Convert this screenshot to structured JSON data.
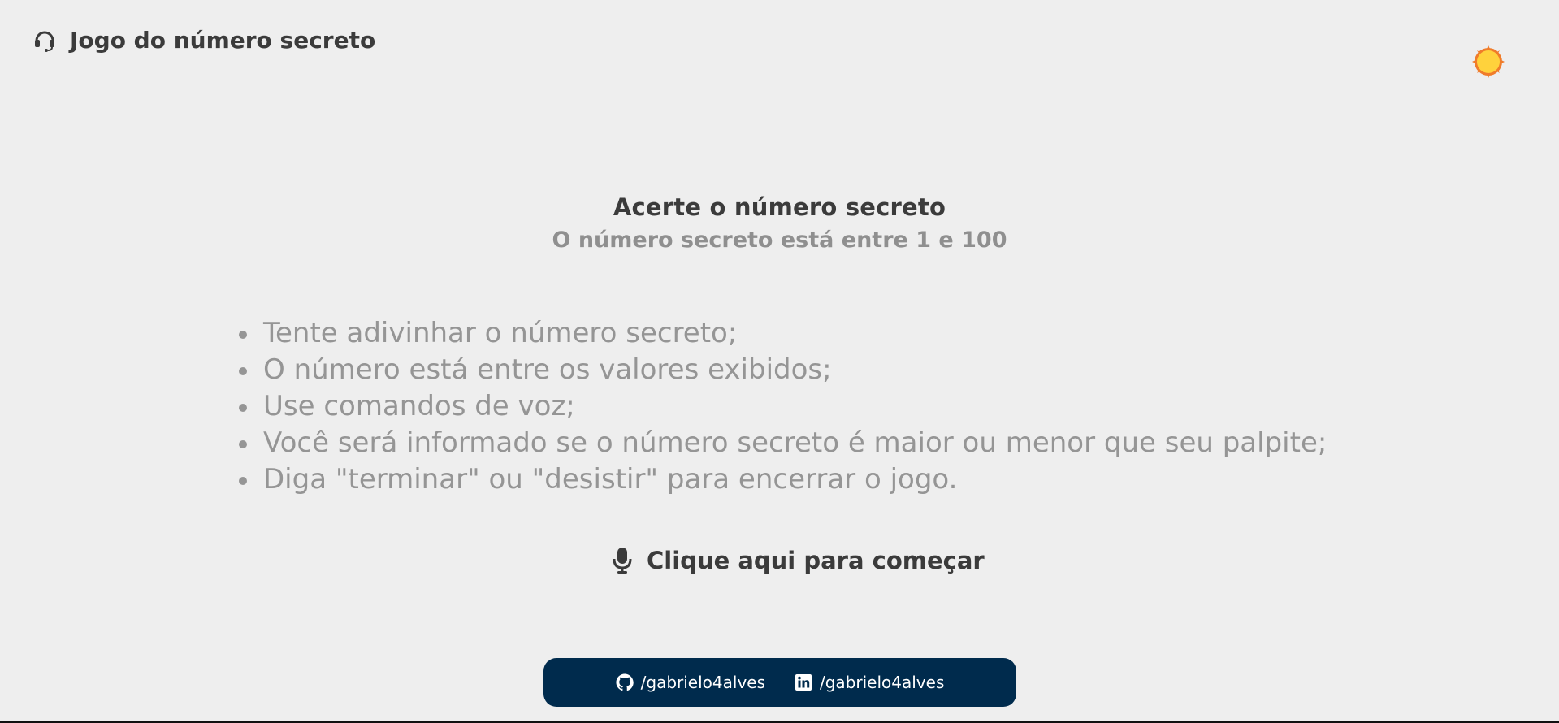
{
  "header": {
    "title": "Jogo do número secreto",
    "icon": "headset-icon"
  },
  "theme_toggle": {
    "icon": "sun-icon",
    "colors": {
      "fill": "#ffd23c",
      "ring": "#f07c2a"
    }
  },
  "main": {
    "title": "Acerte o número secreto",
    "subtitle": "O número secreto está entre 1 e 100",
    "instructions": [
      "Tente adivinhar o número secreto;",
      "O número está entre os valores exibidos;",
      "Use comandos de voz;",
      "Você será informado se o número secreto é maior ou menor que seu palpite;",
      "Diga \"terminar\" ou \"desistir\" para encerrar o jogo."
    ],
    "start_button": {
      "label": "Clique aqui para começar",
      "icon": "microphone-icon"
    }
  },
  "footer": {
    "background": "#002b4d",
    "links": [
      {
        "icon": "github-icon",
        "label": "/gabrielo4alves"
      },
      {
        "icon": "linkedin-icon",
        "label": "/gabrielo4alves"
      }
    ]
  },
  "colors": {
    "background": "#eeeeee",
    "text_dark": "#3b3b3b",
    "text_muted": "#959595"
  }
}
